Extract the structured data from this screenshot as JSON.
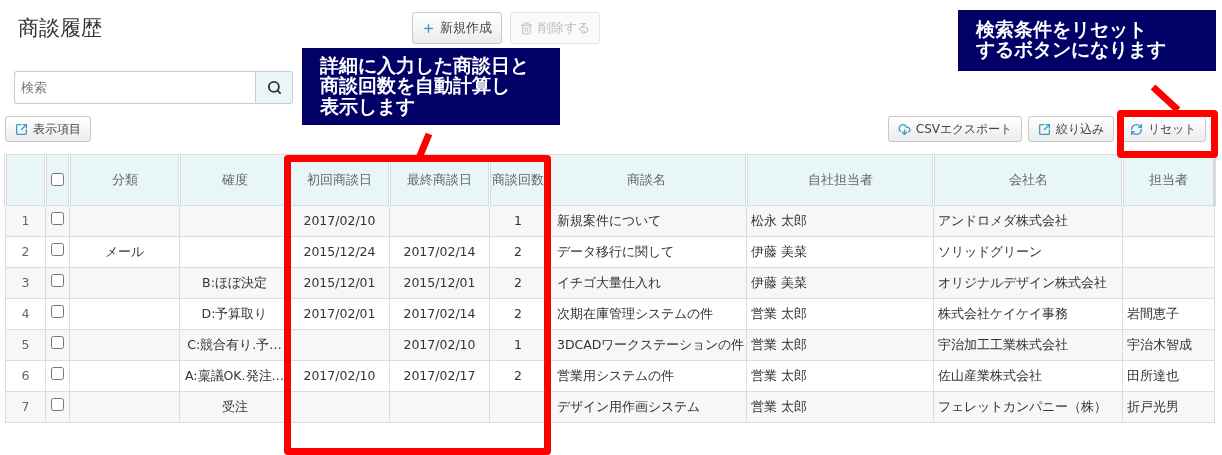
{
  "title": "商談履歴",
  "actions": [
    {
      "label": "新規作成",
      "disabled": false
    },
    {
      "label": "削除する",
      "disabled": true
    }
  ],
  "search": {
    "placeholder": "検索"
  },
  "toolbar_left": [
    {
      "label": "表示項目"
    }
  ],
  "toolbar_right": [
    {
      "label": "CSVエクスポート"
    },
    {
      "label": "絞り込み"
    },
    {
      "label": "リセット"
    }
  ],
  "table": {
    "header_checked": false,
    "columns": [
      "分類",
      "確度",
      "初回商談日",
      "最終商談日",
      "商談回数",
      "商談名",
      "自社担当者",
      "会社名",
      "担当者"
    ],
    "rows": [
      {
        "number": "1",
        "checked": false,
        "cells": [
          "",
          "",
          "2017/02/10",
          "",
          "1",
          "新規案件について",
          "松永 太郎",
          "アンドロメダ株式会社",
          ""
        ]
      },
      {
        "number": "2",
        "checked": false,
        "cells": [
          "メール",
          "",
          "2015/12/24",
          "2017/02/14",
          "2",
          "データ移行に関して",
          "伊藤 美菜",
          "ソリッドグリーン",
          ""
        ]
      },
      {
        "number": "3",
        "checked": false,
        "cells": [
          "",
          "B:ほぼ決定",
          "2015/12/01",
          "2015/12/01",
          "2",
          "イチゴ大量仕入れ",
          "伊藤 美菜",
          "オリジナルデザイン株式会社",
          ""
        ]
      },
      {
        "number": "4",
        "checked": false,
        "cells": [
          "",
          "D:予算取り",
          "2017/02/01",
          "2017/02/14",
          "2",
          "次期在庫管理システムの件",
          "営業 太郎",
          "株式会社ケイケイ事務",
          "岩間恵子"
        ]
      },
      {
        "number": "5",
        "checked": false,
        "cells": [
          "",
          "C:競合有り.予…",
          "",
          "2017/02/10",
          "1",
          "3DCADワークステーションの件",
          "営業 太郎",
          "宇治加工工業株式会社",
          "宇治木智成"
        ]
      },
      {
        "number": "6",
        "checked": false,
        "cells": [
          "",
          "A:稟議OK.発注…",
          "2017/02/10",
          "2017/02/17",
          "2",
          "営業用システムの件",
          "営業 太郎",
          "佐山産業株式会社",
          "田所達也"
        ]
      },
      {
        "number": "7",
        "checked": false,
        "cells": [
          "",
          "受注",
          "",
          "",
          "",
          "デザイン用作画システム",
          "営業 太郎",
          "フェレットカンパニー（株）",
          "折戸光男"
        ]
      }
    ]
  },
  "annotations": [
    {
      "lines": [
        "詳細に入力した商談日と",
        "商談回数を自動計算し",
        "表示します"
      ]
    },
    {
      "lines": [
        "検索条件をリセット",
        "するボタンになります"
      ]
    }
  ]
}
